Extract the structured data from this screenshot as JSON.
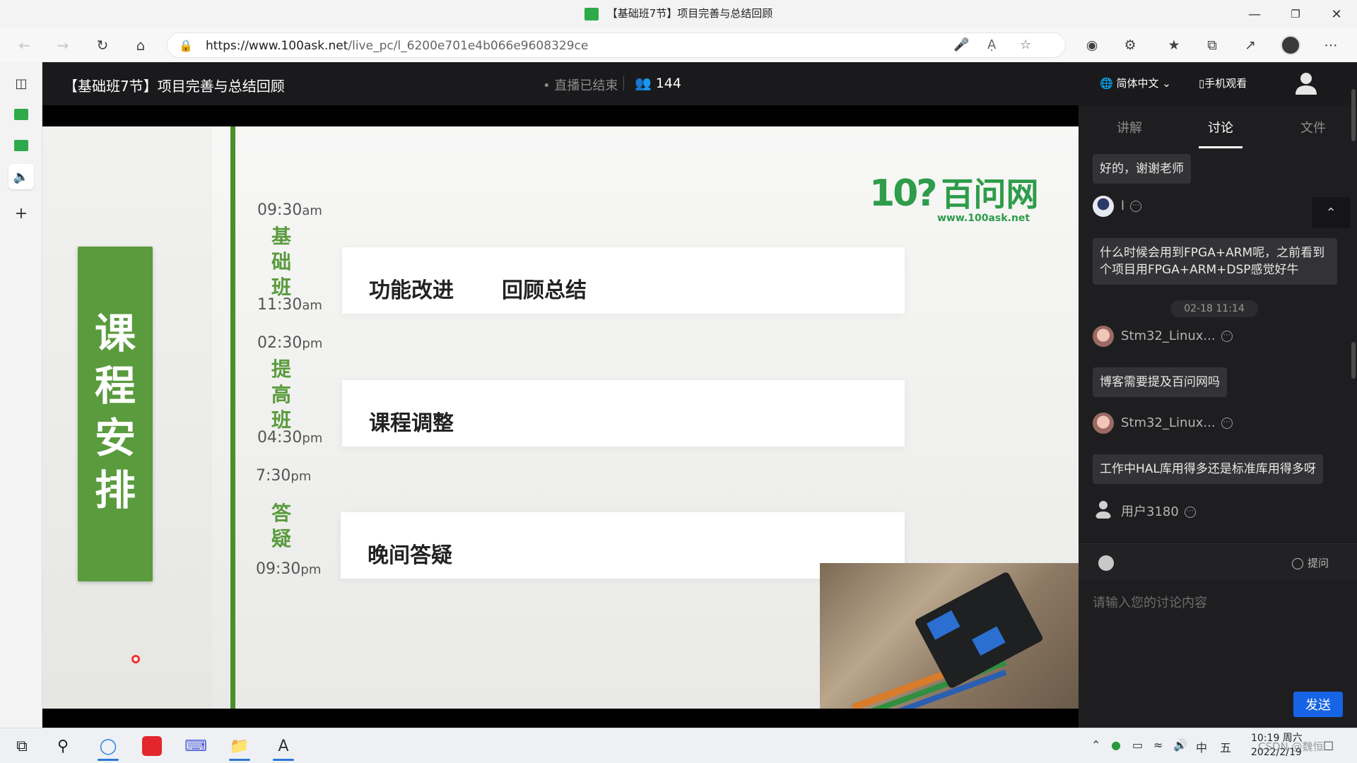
{
  "browser": {
    "tab_title": "【基础班7节】项目完善与总结回顾",
    "url_host": "https://www.100ask.net",
    "url_path": "/live_pc/l_6200e701e4b066e9608329ce"
  },
  "header": {
    "title": "【基础班7节】项目完善与总结回顾",
    "status": "• 直播已结束",
    "viewer_count": "144",
    "language": "简体中文",
    "mobile_watch": "手机观看"
  },
  "slide": {
    "logo_mark": "10?",
    "logo_cn": "百问网",
    "logo_url": "www.100ask.net",
    "panel_title": "课程安排",
    "sections": [
      {
        "label": "基础班",
        "start": "09:30",
        "start_suffix": "am",
        "end": "11:30",
        "end_suffix": "am",
        "items": [
          "功能改进",
          "回顾总结"
        ]
      },
      {
        "label": "提高班",
        "start": "02:30",
        "start_suffix": "pm",
        "end": "04:30",
        "end_suffix": "pm",
        "items": [
          "课程调整"
        ]
      },
      {
        "label": "答疑",
        "start": "7:30",
        "start_suffix": "pm",
        "end": "09:30",
        "end_suffix": "pm",
        "items": [
          "晚间答疑"
        ]
      }
    ]
  },
  "chat": {
    "tabs": [
      "讲解",
      "讨论",
      "文件"
    ],
    "active_tab": "讨论",
    "messages": [
      {
        "type": "bubble",
        "text": "好的，谢谢老师"
      },
      {
        "type": "user",
        "name": "l"
      },
      {
        "type": "bubble",
        "text": "什么时候会用到FPGA+ARM呢，之前看到个项目用FPGA+ARM+DSP感觉好牛"
      },
      {
        "type": "date",
        "text": "02-18 11:14"
      },
      {
        "type": "user",
        "name": "Stm32_Linux..."
      },
      {
        "type": "bubble",
        "text": "博客需要提及百问网吗"
      },
      {
        "type": "user",
        "name": "Stm32_Linux..."
      },
      {
        "type": "bubble",
        "text": "工作中HAL库用得多还是标准库用得多呀"
      },
      {
        "type": "user",
        "name": "用户3180"
      }
    ],
    "ask_label": "提问",
    "input_placeholder": "请输入您的讨论内容",
    "send_label": "发送"
  },
  "taskbar": {
    "ime": "中",
    "ime_mode": "五",
    "time": "10:19 周六",
    "date": "2022/2/19",
    "watermark": "CSDN @魏恒"
  },
  "colors": {
    "accent_green": "#5a9b3e",
    "send_blue": "#1663e6",
    "header_bg": "#1a1a1c"
  }
}
